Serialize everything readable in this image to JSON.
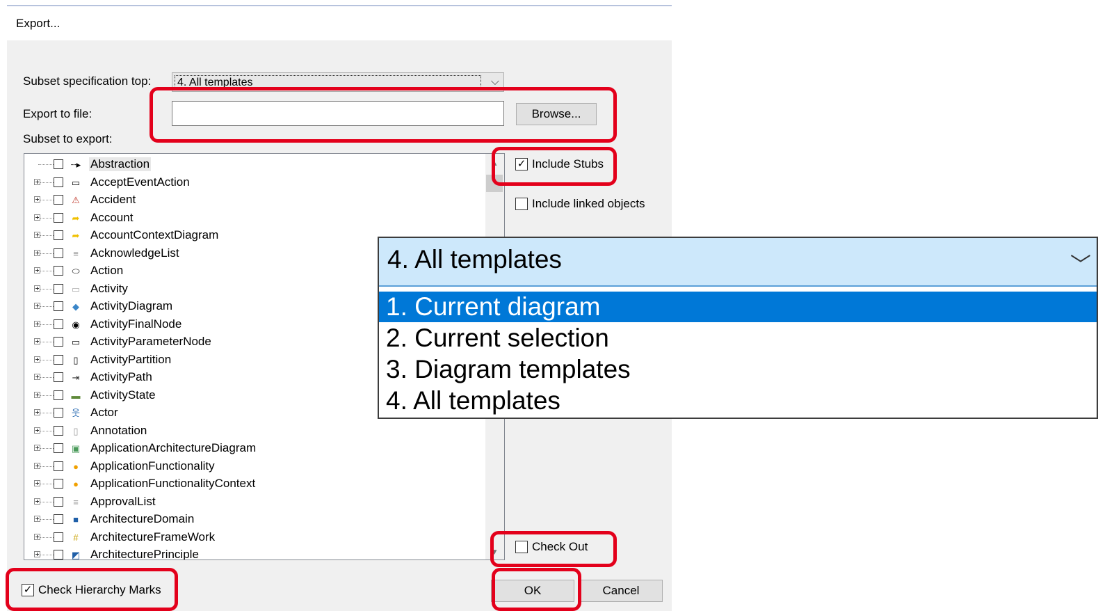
{
  "window": {
    "title": "Export..."
  },
  "form": {
    "subset_spec_label": "Subset specification top:",
    "subset_spec_value": "4. All templates",
    "export_file_label": "Export to file:",
    "export_file_value": "",
    "browse_label": "Browse...",
    "subset_to_export_label": "Subset to export:"
  },
  "tree": {
    "items": [
      {
        "label": "Abstraction",
        "icon": "arrow-icon",
        "glyph": "┈▸",
        "color": "#000000",
        "expandable": false,
        "selected": true
      },
      {
        "label": "AcceptEventAction",
        "icon": "accept-event-icon",
        "glyph": "▭",
        "color": "#000000",
        "expandable": true
      },
      {
        "label": "Accident",
        "icon": "accident-icon",
        "glyph": "⚠",
        "color": "#c0392b",
        "expandable": true
      },
      {
        "label": "Account",
        "icon": "account-icon",
        "glyph": "➦",
        "color": "#f0c000",
        "expandable": true
      },
      {
        "label": "AccountContextDiagram",
        "icon": "account-context-icon",
        "glyph": "➦",
        "color": "#f0c000",
        "expandable": true
      },
      {
        "label": "AcknowledgeList",
        "icon": "list-icon",
        "glyph": "≡",
        "color": "#999999",
        "expandable": true
      },
      {
        "label": "Action",
        "icon": "action-icon",
        "glyph": "⬭",
        "color": "#000000",
        "expandable": true
      },
      {
        "label": "Activity",
        "icon": "activity-icon",
        "glyph": "▭",
        "color": "#aaaaaa",
        "expandable": true
      },
      {
        "label": "ActivityDiagram",
        "icon": "activity-diagram-icon",
        "glyph": "◆",
        "color": "#3a86c8",
        "expandable": true
      },
      {
        "label": "ActivityFinalNode",
        "icon": "final-node-icon",
        "glyph": "◉",
        "color": "#000000",
        "expandable": true
      },
      {
        "label": "ActivityParameterNode",
        "icon": "parameter-node-icon",
        "glyph": "▭",
        "color": "#000000",
        "expandable": true
      },
      {
        "label": "ActivityPartition",
        "icon": "partition-icon",
        "glyph": "▯",
        "color": "#000000",
        "expandable": true
      },
      {
        "label": "ActivityPath",
        "icon": "path-icon",
        "glyph": "⇥",
        "color": "#333333",
        "expandable": true
      },
      {
        "label": "ActivityState",
        "icon": "state-icon",
        "glyph": "▬",
        "color": "#5f8a3a",
        "expandable": true
      },
      {
        "label": "Actor",
        "icon": "actor-icon",
        "glyph": "웃",
        "color": "#2f6fb5",
        "expandable": true
      },
      {
        "label": "Annotation",
        "icon": "annotation-icon",
        "glyph": "▯",
        "color": "#999999",
        "expandable": true
      },
      {
        "label": "ApplicationArchitectureDiagram",
        "icon": "app-architecture-icon",
        "glyph": "▣",
        "color": "#4a9a5a",
        "expandable": true
      },
      {
        "label": "ApplicationFunctionality",
        "icon": "app-functionality-icon",
        "glyph": "●",
        "color": "#f0a000",
        "expandable": true
      },
      {
        "label": "ApplicationFunctionalityContext",
        "icon": "app-functionality-context-icon",
        "glyph": "●",
        "color": "#f0a000",
        "expandable": true
      },
      {
        "label": "ApprovalList",
        "icon": "list-icon",
        "glyph": "≡",
        "color": "#999999",
        "expandable": true
      },
      {
        "label": "ArchitectureDomain",
        "icon": "architecture-domain-icon",
        "glyph": "■",
        "color": "#1f5fa8",
        "expandable": true
      },
      {
        "label": "ArchitectureFrameWork",
        "icon": "framework-icon",
        "glyph": "#",
        "color": "#c8a000",
        "expandable": true
      },
      {
        "label": "ArchitecturePrinciple",
        "icon": "principle-icon",
        "glyph": "◩",
        "color": "#1f5fa8",
        "expandable": true
      }
    ]
  },
  "options": {
    "include_stubs": {
      "label": "Include Stubs",
      "checked": true
    },
    "include_linked": {
      "label": "Include linked objects",
      "checked": false
    },
    "check_out": {
      "label": "Check Out",
      "checked": false
    },
    "check_hierarchy": {
      "label": "Check Hierarchy Marks",
      "checked": true
    }
  },
  "buttons": {
    "ok": "OK",
    "cancel": "Cancel"
  },
  "dropdown": {
    "selected": "4. All templates",
    "options": [
      "1. Current diagram",
      "2. Current selection",
      "3. Diagram templates",
      "4. All templates"
    ],
    "highlighted_index": 0
  },
  "colors": {
    "highlight": "#e3001b",
    "selection": "#0078d7"
  }
}
